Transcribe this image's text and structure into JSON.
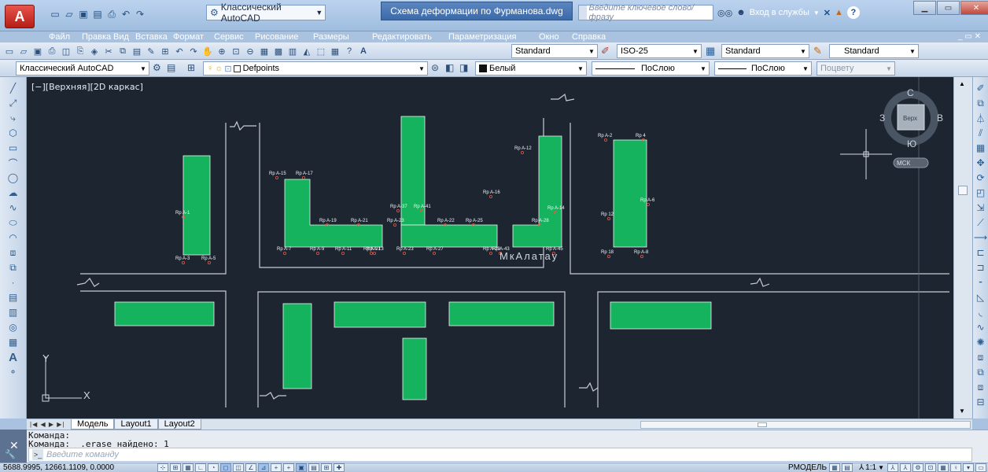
{
  "window": {
    "workspace": "Классический AutoCAD",
    "doc_title": "Схема деформации по Фурманова.dwg",
    "search_placeholder": "Введите ключевое слово/фразу",
    "login": "Вход в службы",
    "help": "?"
  },
  "menu": [
    "Файл",
    "Правка",
    "Вид",
    "Вставка",
    "Формат",
    "Сервис",
    "Рисование",
    "Размеры",
    "Редактировать",
    "Параметризация",
    "Окно",
    "Справка"
  ],
  "toolbar1": {
    "text_style": "Standard",
    "dim_style": "ISO-25",
    "table_style": "Standard",
    "mleader_style": "Standard"
  },
  "toolbar2": {
    "workspace": "Классический AutoCAD",
    "layer": "Defpoints",
    "color": "Белый",
    "linetype": "ПоСлою",
    "lineweight": "ПоСлою",
    "plotstyle": "Поцвету"
  },
  "viewport": {
    "label": "[−][Верхняя][2D каркас]",
    "compass": {
      "n": "С",
      "s": "Ю",
      "w": "З",
      "e": "В",
      "center": "Верх",
      "ucs": "МСК"
    },
    "ucs_x": "X",
    "ucs_y": "Y",
    "place_name": "МкАлатау"
  },
  "points": [
    "Rp A-15",
    "Rp A-17",
    "Rp A-1",
    "Rp A-3",
    "Rp A-5",
    "Rp A-7",
    "Rp A-9",
    "Rp A-11",
    "Rp A-13",
    "Rp A-19",
    "Rp A-21",
    "Rp A-21",
    "Rp A-23",
    "Rp A-23",
    "Rp A-27",
    "Rp A-22",
    "Rp A-25",
    "Rp A-29",
    "Rp A-37",
    "Rp A-41",
    "Rp A-16",
    "Rp A-12",
    "Rp A-14",
    "Rp A-28",
    "Rp A-43",
    "Rp A-45",
    "Rp A-2",
    "Rp 4",
    "Rp A-6",
    "Rp 12",
    "Rp A-8",
    "Rp 18"
  ],
  "tabs": [
    "Модель",
    "Layout1",
    "Layout2"
  ],
  "command": {
    "line1": "Команда:",
    "line2": "Команда: _.erase найдено: 1",
    "placeholder": "Введите команду"
  },
  "status": {
    "coords": "5688.9995, 12661.1109, 0.0000",
    "model": "РМОДЕЛЬ",
    "scale": "1:1"
  },
  "colors": {
    "canvas": "#1d2530",
    "building": "#16b35e",
    "line": "#c9cdd2",
    "accent": "#c0392b"
  }
}
